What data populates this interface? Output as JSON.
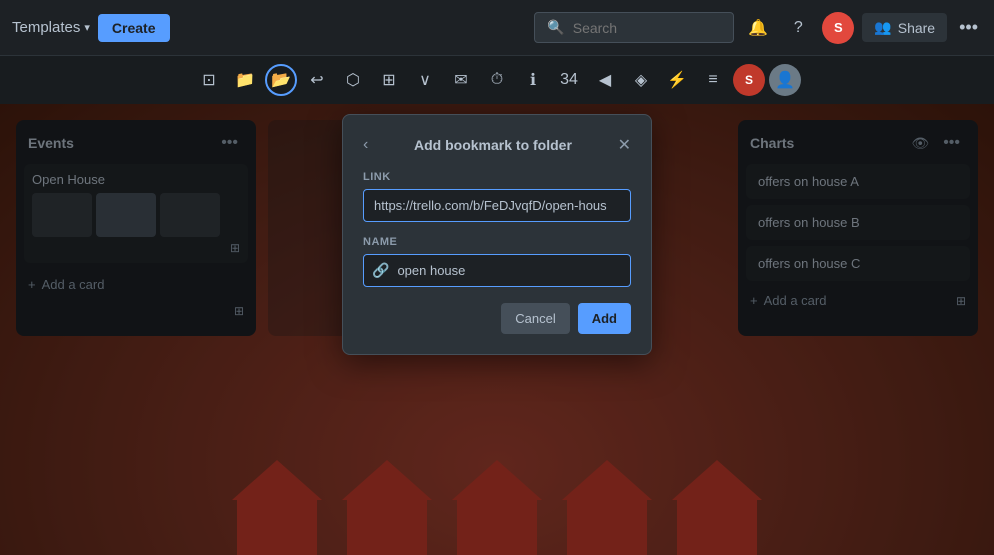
{
  "topnav": {
    "templates_label": "Templates",
    "create_label": "Create",
    "search_placeholder": "Search",
    "share_label": "Share",
    "user_initial": "S"
  },
  "toolbar": {
    "icons": [
      "⊡",
      "📁",
      "📂",
      "↩",
      "⬡",
      "∨",
      "✉",
      "⏱",
      "ℹ",
      "34",
      "◀",
      "◈",
      "⚡",
      "≡",
      "S",
      "👤"
    ]
  },
  "columns": [
    {
      "id": "events",
      "title": "Events",
      "cards": [
        {
          "id": "open-house",
          "title": "Open House",
          "has_thumbs": true
        }
      ],
      "add_card_label": "Add a card"
    },
    {
      "id": "charts",
      "title": "Charts",
      "items": [
        {
          "id": "offers-a",
          "text": "offers on house A"
        },
        {
          "id": "offers-b",
          "text": "offers on house B"
        },
        {
          "id": "offers-c",
          "text": "offers on house C"
        }
      ],
      "add_card_label": "Add a card"
    }
  ],
  "dialog": {
    "title": "Add bookmark to folder",
    "link_label": "Link",
    "link_value": "https://trello.com/b/FeDJvqfD/open-hous",
    "name_label": "Name",
    "name_value": "open house",
    "cancel_label": "Cancel",
    "add_label": "Add"
  }
}
